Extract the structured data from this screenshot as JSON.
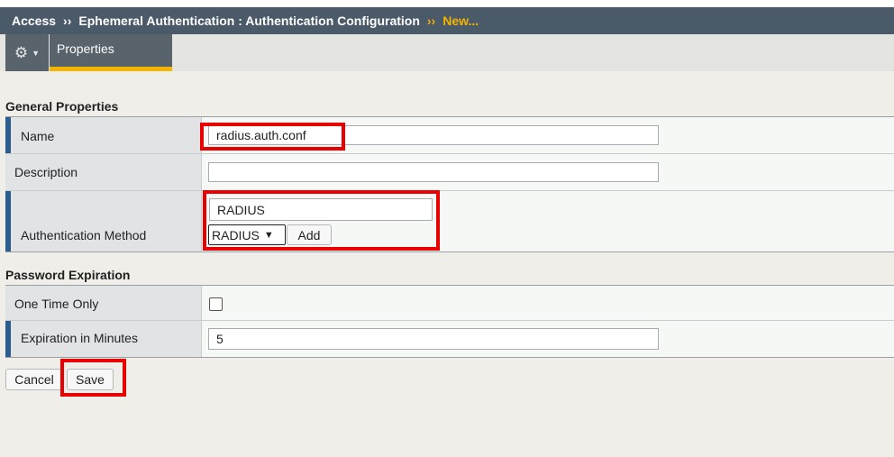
{
  "breadcrumb": {
    "root": "Access",
    "separator": "››",
    "parent": "Ephemeral Authentication : Authentication Configuration",
    "current": "New..."
  },
  "tabs": {
    "gear_icon": "gear-icon",
    "properties_label": "Properties"
  },
  "general": {
    "title": "General Properties",
    "name_label": "Name",
    "name_value": "radius.auth.conf",
    "description_label": "Description",
    "description_value": "",
    "auth_method_label": "Authentication Method",
    "auth_method_value": "RADIUS",
    "auth_method_selected": "RADIUS",
    "add_label": "Add"
  },
  "password": {
    "title": "Password Expiration",
    "one_time_label": "One Time Only",
    "one_time_checked": false,
    "expiration_label": "Expiration in Minutes",
    "expiration_value": "5"
  },
  "actions": {
    "cancel_label": "Cancel",
    "save_label": "Save"
  },
  "colors": {
    "header_bg": "#4b5a69",
    "accent": "#f5b400",
    "highlight": "#e90000",
    "required_bar": "#2d5d8c"
  }
}
